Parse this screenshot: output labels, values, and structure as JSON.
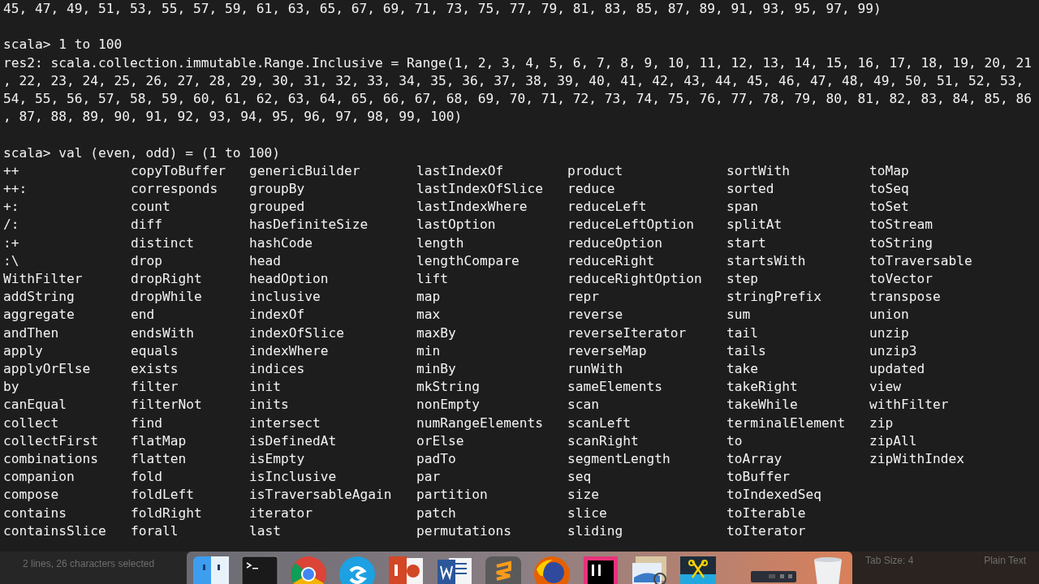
{
  "terminal": {
    "blocks": [
      {
        "lines": [
          "45, 47, 49, 51, 53, 55, 57, 59, 61, 63, 65, 67, 69, 71, 73, 75, 77, 79, 81, 83, 85, 87, 89, 91, 93, 95, 97, 99)"
        ]
      },
      {
        "lines": [
          "scala> 1 to 100",
          "res2: scala.collection.immutable.Range.Inclusive = Range(1, 2, 3, 4, 5, 6, 7, 8, 9, 10, 11, 12, 13, 14, 15, 16, 17, 18, 19, 20, 21",
          ", 22, 23, 24, 25, 26, 27, 28, 29, 30, 31, 32, 33, 34, 35, 36, 37, 38, 39, 40, 41, 42, 43, 44, 45, 46, 47, 48, 49, 50, 51, 52, 53,",
          "54, 55, 56, 57, 58, 59, 60, 61, 62, 63, 64, 65, 66, 67, 68, 69, 70, 71, 72, 73, 74, 75, 76, 77, 78, 79, 80, 81, 82, 83, 84, 85, 86",
          ", 87, 88, 89, 90, 91, 92, 93, 94, 95, 96, 97, 98, 99, 100)"
        ]
      },
      {
        "lines": [
          "scala> val (even, odd) = (1 to 100)"
        ]
      }
    ],
    "completions": [
      [
        "++",
        "++:",
        "+:",
        "/:",
        ":+",
        ":\\",
        "WithFilter",
        "addString",
        "aggregate",
        "andThen",
        "apply",
        "applyOrElse",
        "by",
        "canEqual",
        "collect",
        "collectFirst",
        "combinations",
        "companion",
        "compose",
        "contains",
        "containsSlice"
      ],
      [
        "copyToBuffer",
        "corresponds",
        "count",
        "diff",
        "distinct",
        "drop",
        "dropRight",
        "dropWhile",
        "end",
        "endsWith",
        "equals",
        "exists",
        "filter",
        "filterNot",
        "find",
        "flatMap",
        "flatten",
        "fold",
        "foldLeft",
        "foldRight",
        "forall"
      ],
      [
        "genericBuilder",
        "groupBy",
        "grouped",
        "hasDefiniteSize",
        "hashCode",
        "head",
        "headOption",
        "inclusive",
        "indexOf",
        "indexOfSlice",
        "indexWhere",
        "indices",
        "init",
        "inits",
        "intersect",
        "isDefinedAt",
        "isEmpty",
        "isInclusive",
        "isTraversableAgain",
        "iterator",
        "last"
      ],
      [
        "lastIndexOf",
        "lastIndexOfSlice",
        "lastIndexWhere",
        "lastOption",
        "length",
        "lengthCompare",
        "lift",
        "map",
        "max",
        "maxBy",
        "min",
        "minBy",
        "mkString",
        "nonEmpty",
        "numRangeElements",
        "orElse",
        "padTo",
        "par",
        "partition",
        "patch",
        "permutations"
      ],
      [
        "product",
        "reduce",
        "reduceLeft",
        "reduceLeftOption",
        "reduceOption",
        "reduceRight",
        "reduceRightOption",
        "repr",
        "reverse",
        "reverseIterator",
        "reverseMap",
        "runWith",
        "sameElements",
        "scan",
        "scanLeft",
        "scanRight",
        "segmentLength",
        "seq",
        "size",
        "slice",
        "sliding"
      ],
      [
        "sortWith",
        "sorted",
        "span",
        "splitAt",
        "start",
        "startsWith",
        "step",
        "stringPrefix",
        "sum",
        "tail",
        "tails",
        "take",
        "takeRight",
        "takeWhile",
        "terminalElement",
        "to",
        "toArray",
        "toBuffer",
        "toIndexedSeq",
        "toIterable",
        "toIterator"
      ],
      [
        "toMap",
        "toSeq",
        "toSet",
        "toStream",
        "toString",
        "toTraversable",
        "toVector",
        "transpose",
        "union",
        "unzip",
        "unzip3",
        "updated",
        "view",
        "withFilter",
        "zip",
        "zipAll",
        "zipWithIndex"
      ]
    ]
  },
  "status_bar": {
    "selection": "2 lines, 26 characters selected",
    "tab_size": "Tab Size: 4",
    "syntax": "Plain Text"
  },
  "dock": {
    "apps": [
      {
        "kind": "finder"
      },
      {
        "kind": "terminal"
      },
      {
        "kind": "chrome"
      },
      {
        "kind": "skype"
      },
      {
        "kind": "powerpoint"
      },
      {
        "kind": "word"
      },
      {
        "kind": "sublime"
      },
      {
        "kind": "firefox"
      },
      {
        "kind": "intellij"
      },
      {
        "kind": "preview"
      },
      {
        "kind": "screenshot"
      },
      {
        "kind": "separator"
      },
      {
        "kind": "device"
      },
      {
        "kind": "trash"
      }
    ]
  }
}
